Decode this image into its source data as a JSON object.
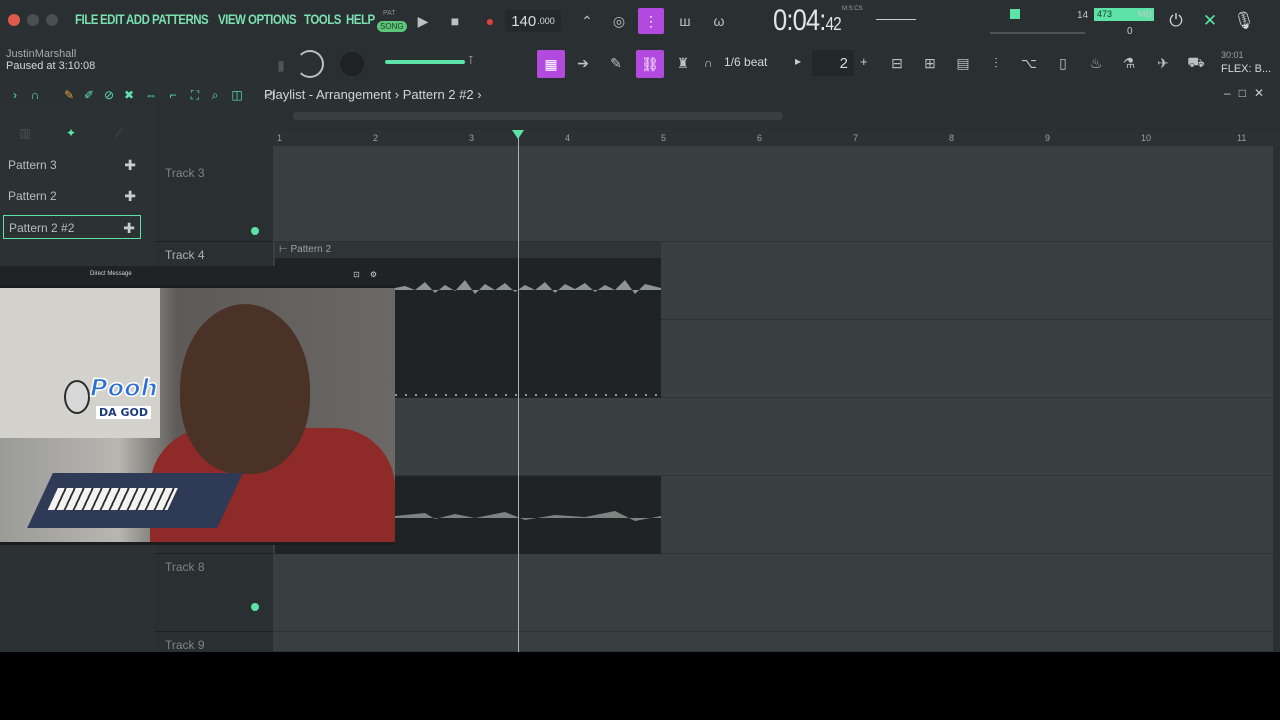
{
  "menu": [
    "FILE",
    "EDIT",
    "ADD",
    "PATTERNS",
    "VIEW",
    "OPTIONS",
    "TOOLS",
    "HELP"
  ],
  "transport": {
    "pat_label": "PAT",
    "song_label": "SONG",
    "tempo": "140",
    "tempo_decimal": ".000",
    "time": "0:04:",
    "time_small": "42",
    "time_unit": "M:S:CS"
  },
  "stats": {
    "cpu_cores": "14",
    "memory": "473",
    "memory_unit": "MB",
    "polyphony": "0"
  },
  "user": {
    "name": "JustinMarshall",
    "status": "Paused at 3:10:08"
  },
  "snap": {
    "value": "1/6 beat",
    "stepper_value": "2"
  },
  "flex": {
    "top": "30:01",
    "bottom": "FLEX: B..."
  },
  "playlist": {
    "title": "Playlist - Arrangement",
    "separator": "›",
    "current_pattern": "Pattern 2 #2",
    "patterns": [
      "Pattern 3",
      "Pattern 2",
      "Pattern 2 #2"
    ],
    "selected_pattern": 2,
    "tracks": [
      {
        "name": "Track 3"
      },
      {
        "name": "Track 4"
      },
      {
        "name": ""
      },
      {
        "name": ""
      },
      {
        "name": ""
      },
      {
        "name": "Track 8"
      },
      {
        "name": "Track 9"
      }
    ],
    "bar_numbers": [
      "1",
      "2",
      "3",
      "4",
      "5",
      "6",
      "7",
      "8",
      "9",
      "10",
      "11"
    ],
    "clip_label": "Pattern 2"
  },
  "webcam": {
    "title": "Direct Message",
    "logo_text": "Pooh",
    "logo_sub": "DA GOD"
  },
  "colors": {
    "accent": "#5de3a8",
    "purple": "#b34ae0",
    "background": "#2a2f32"
  }
}
